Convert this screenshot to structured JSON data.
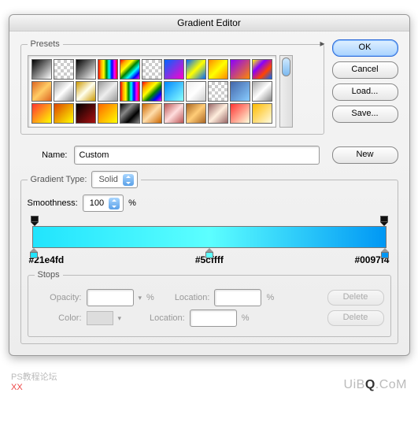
{
  "title": "Gradient Editor",
  "buttons": {
    "ok": "OK",
    "cancel": "Cancel",
    "load": "Load...",
    "save": "Save...",
    "new": "New"
  },
  "presets": {
    "legend": "Presets"
  },
  "name": {
    "label": "Name:",
    "value": "Custom"
  },
  "gradient": {
    "type_label": "Gradient Type:",
    "type_value": "Solid",
    "smooth_label": "Smoothness:",
    "smooth_value": "100",
    "smooth_unit": "%",
    "hex": {
      "left": "#21e4fd",
      "mid": "#5cffff",
      "right": "#0097f4"
    }
  },
  "stops": {
    "legend": "Stops",
    "opacity_label": "Opacity:",
    "opacity_value": "",
    "unit": "%",
    "color_label": "Color:",
    "location_label": "Location:",
    "location_value": "",
    "delete": "Delete"
  },
  "watermark": {
    "line1": "PS教程论坛",
    "line2": "XX",
    "logo": "UiBQ.CoM"
  },
  "swatches": [
    "linear-gradient(135deg,#000,#fff)",
    "repeating-conic-gradient(#ccc 0 25%,#fff 0 50%) 0/8px 8px",
    "linear-gradient(135deg,#000,#fff)",
    "linear-gradient(90deg,red,orange,yellow,green,cyan,blue,magenta,red)",
    "linear-gradient(135deg,red,orange,yellow,green,cyan,blue,magenta)",
    "repeating-conic-gradient(#ccc 0 25%,#fff 0 50%) 0/8px 8px",
    "linear-gradient(135deg,#06f,#f0c)",
    "linear-gradient(135deg,#06f,#ff0,#06f)",
    "linear-gradient(135deg,#f80,#ff0,#f80)",
    "linear-gradient(135deg,#80f,#f80)",
    "linear-gradient(135deg,#ff0,#80f,#f40,#06f)",
    "linear-gradient(135deg,#d62,#fc6,#d62)",
    "linear-gradient(135deg,#aaa,#fff,#888)",
    "linear-gradient(135deg,#c90,#ffe,#c90)",
    "linear-gradient(135deg,#999,#eee,#999)",
    "linear-gradient(90deg,red,orange,yellow,green,cyan,blue,magenta,red)",
    "linear-gradient(135deg,red,orange,yellow,green,blue,magenta)",
    "linear-gradient(135deg,#08f,#8ff)",
    "linear-gradient(135deg,#eee,#fff,#ccc)",
    "repeating-conic-gradient(#ccc 0 25%,#fff 0 50%) 0/8px 8px",
    "linear-gradient(135deg,#46a,#8cf)",
    "linear-gradient(135deg,#aaa,#fff,#888)",
    "linear-gradient(135deg,#f33,#ff0)",
    "linear-gradient(135deg,#d40,#ff0)",
    "linear-gradient(135deg,#000,#a11)",
    "linear-gradient(135deg,#f60,#ff0)",
    "linear-gradient(135deg,#000,#888,#000,#888)",
    "linear-gradient(135deg,#c60,#fda,#c60)",
    "linear-gradient(135deg,#b55,#fdd,#b55)",
    "linear-gradient(135deg,#a62,#fc7,#a62)",
    "linear-gradient(135deg,#966,#fed,#966)",
    "linear-gradient(135deg,#f33,#ffd)",
    "linear-gradient(135deg,#fb0,#fffbe0)"
  ]
}
